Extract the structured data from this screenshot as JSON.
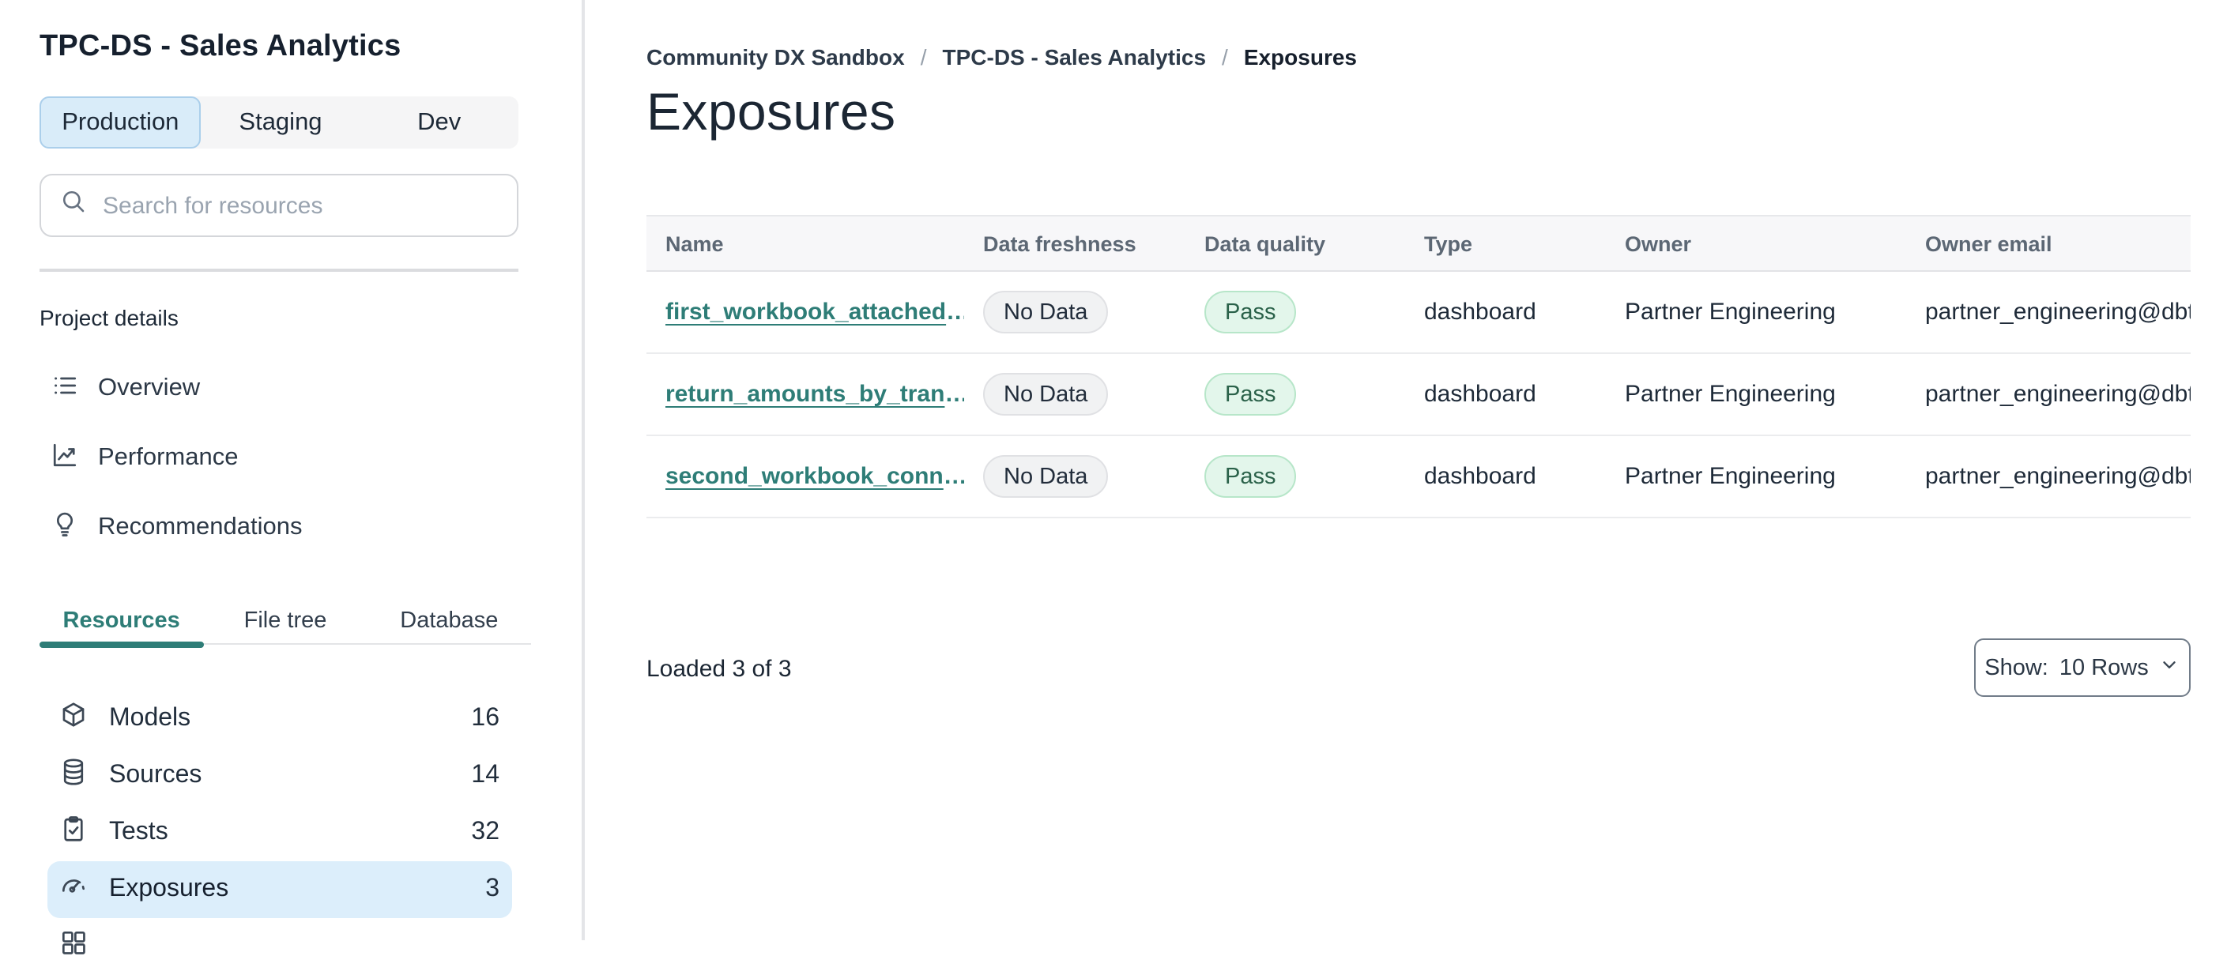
{
  "sidebar": {
    "project_title": "TPC-DS - Sales Analytics",
    "env_tabs": [
      {
        "label": "Production",
        "selected": true
      },
      {
        "label": "Staging",
        "selected": false
      },
      {
        "label": "Dev",
        "selected": false
      }
    ],
    "search_placeholder": "Search for resources",
    "section_label": "Project details",
    "nav": [
      {
        "label": "Overview",
        "icon": "list-icon"
      },
      {
        "label": "Performance",
        "icon": "chart-line-icon"
      },
      {
        "label": "Recommendations",
        "icon": "lightbulb-icon"
      }
    ],
    "resource_tabs": [
      {
        "label": "Resources",
        "active": true
      },
      {
        "label": "File tree",
        "active": false
      },
      {
        "label": "Database",
        "active": false
      }
    ],
    "resources": [
      {
        "label": "Models",
        "count": "16",
        "icon": "cube-icon",
        "selected": false
      },
      {
        "label": "Sources",
        "count": "14",
        "icon": "database-icon",
        "selected": false
      },
      {
        "label": "Tests",
        "count": "32",
        "icon": "clipboard-check-icon",
        "selected": false
      },
      {
        "label": "Exposures",
        "count": "3",
        "icon": "gauge-icon",
        "selected": true
      }
    ]
  },
  "breadcrumb": {
    "separator": "/",
    "items": [
      {
        "label": "Community DX Sandbox"
      },
      {
        "label": "TPC-DS - Sales Analytics"
      },
      {
        "label": "Exposures"
      }
    ]
  },
  "page": {
    "title": "Exposures"
  },
  "table": {
    "columns": [
      "Name",
      "Data freshness",
      "Data quality",
      "Type",
      "Owner",
      "Owner email"
    ],
    "rows": [
      {
        "name": "first_workbook_attached",
        "ellipsis": "…",
        "freshness": "No Data",
        "quality": "Pass",
        "type": "dashboard",
        "owner": "Partner Engineering",
        "owner_email": "partner_engineering@dbt…"
      },
      {
        "name": "return_amounts_by_tran",
        "ellipsis": "…",
        "freshness": "No Data",
        "quality": "Pass",
        "type": "dashboard",
        "owner": "Partner Engineering",
        "owner_email": "partner_engineering@dbt…"
      },
      {
        "name": "second_workbook_conn",
        "ellipsis": "…",
        "freshness": "No Data",
        "quality": "Pass",
        "type": "dashboard",
        "owner": "Partner Engineering",
        "owner_email": "partner_engineering@dbt…"
      }
    ]
  },
  "footer": {
    "loaded": "Loaded 3 of 3",
    "show_label": "Show:",
    "show_value": "10 Rows"
  },
  "colors": {
    "accent_teal": "#2e7d77",
    "selection_blue": "#dceefb",
    "env_selected_bg": "#d9ecf9",
    "env_selected_border": "#abcfeb",
    "badge_gray_bg": "#f1f2f3",
    "badge_green_bg": "#e3f6eb",
    "badge_green_border": "#b7e6c9",
    "badge_green_text": "#2a6149",
    "table_header_bg": "#f7f7f9"
  }
}
